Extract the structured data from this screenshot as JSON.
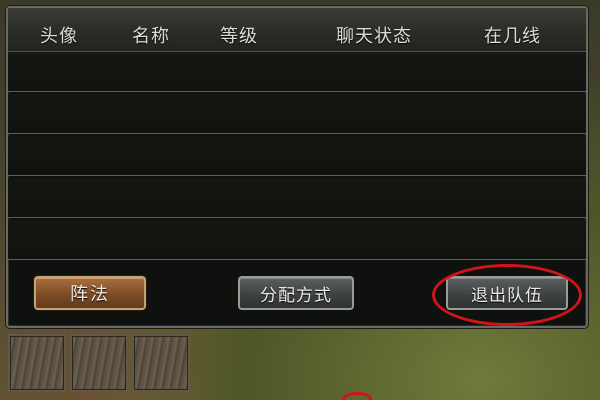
{
  "table": {
    "headers": {
      "avatar": "头像",
      "name": "名称",
      "level": "等级",
      "chat_status": "聊天状态",
      "line": "在几线"
    },
    "rows": [
      {
        "avatar": "",
        "name": "",
        "level": "",
        "chat_status": "",
        "line": ""
      },
      {
        "avatar": "",
        "name": "",
        "level": "",
        "chat_status": "",
        "line": ""
      },
      {
        "avatar": "",
        "name": "",
        "level": "",
        "chat_status": "",
        "line": ""
      },
      {
        "avatar": "",
        "name": "",
        "level": "",
        "chat_status": "",
        "line": ""
      },
      {
        "avatar": "",
        "name": "",
        "level": "",
        "chat_status": "",
        "line": ""
      }
    ]
  },
  "buttons": {
    "formation": "阵法",
    "distribute": "分配方式",
    "leave_team": "退出队伍"
  },
  "colors": {
    "highlight_circle": "#d0141a",
    "formation_button": "#7d4c26",
    "panel_background": "#0f110e"
  }
}
